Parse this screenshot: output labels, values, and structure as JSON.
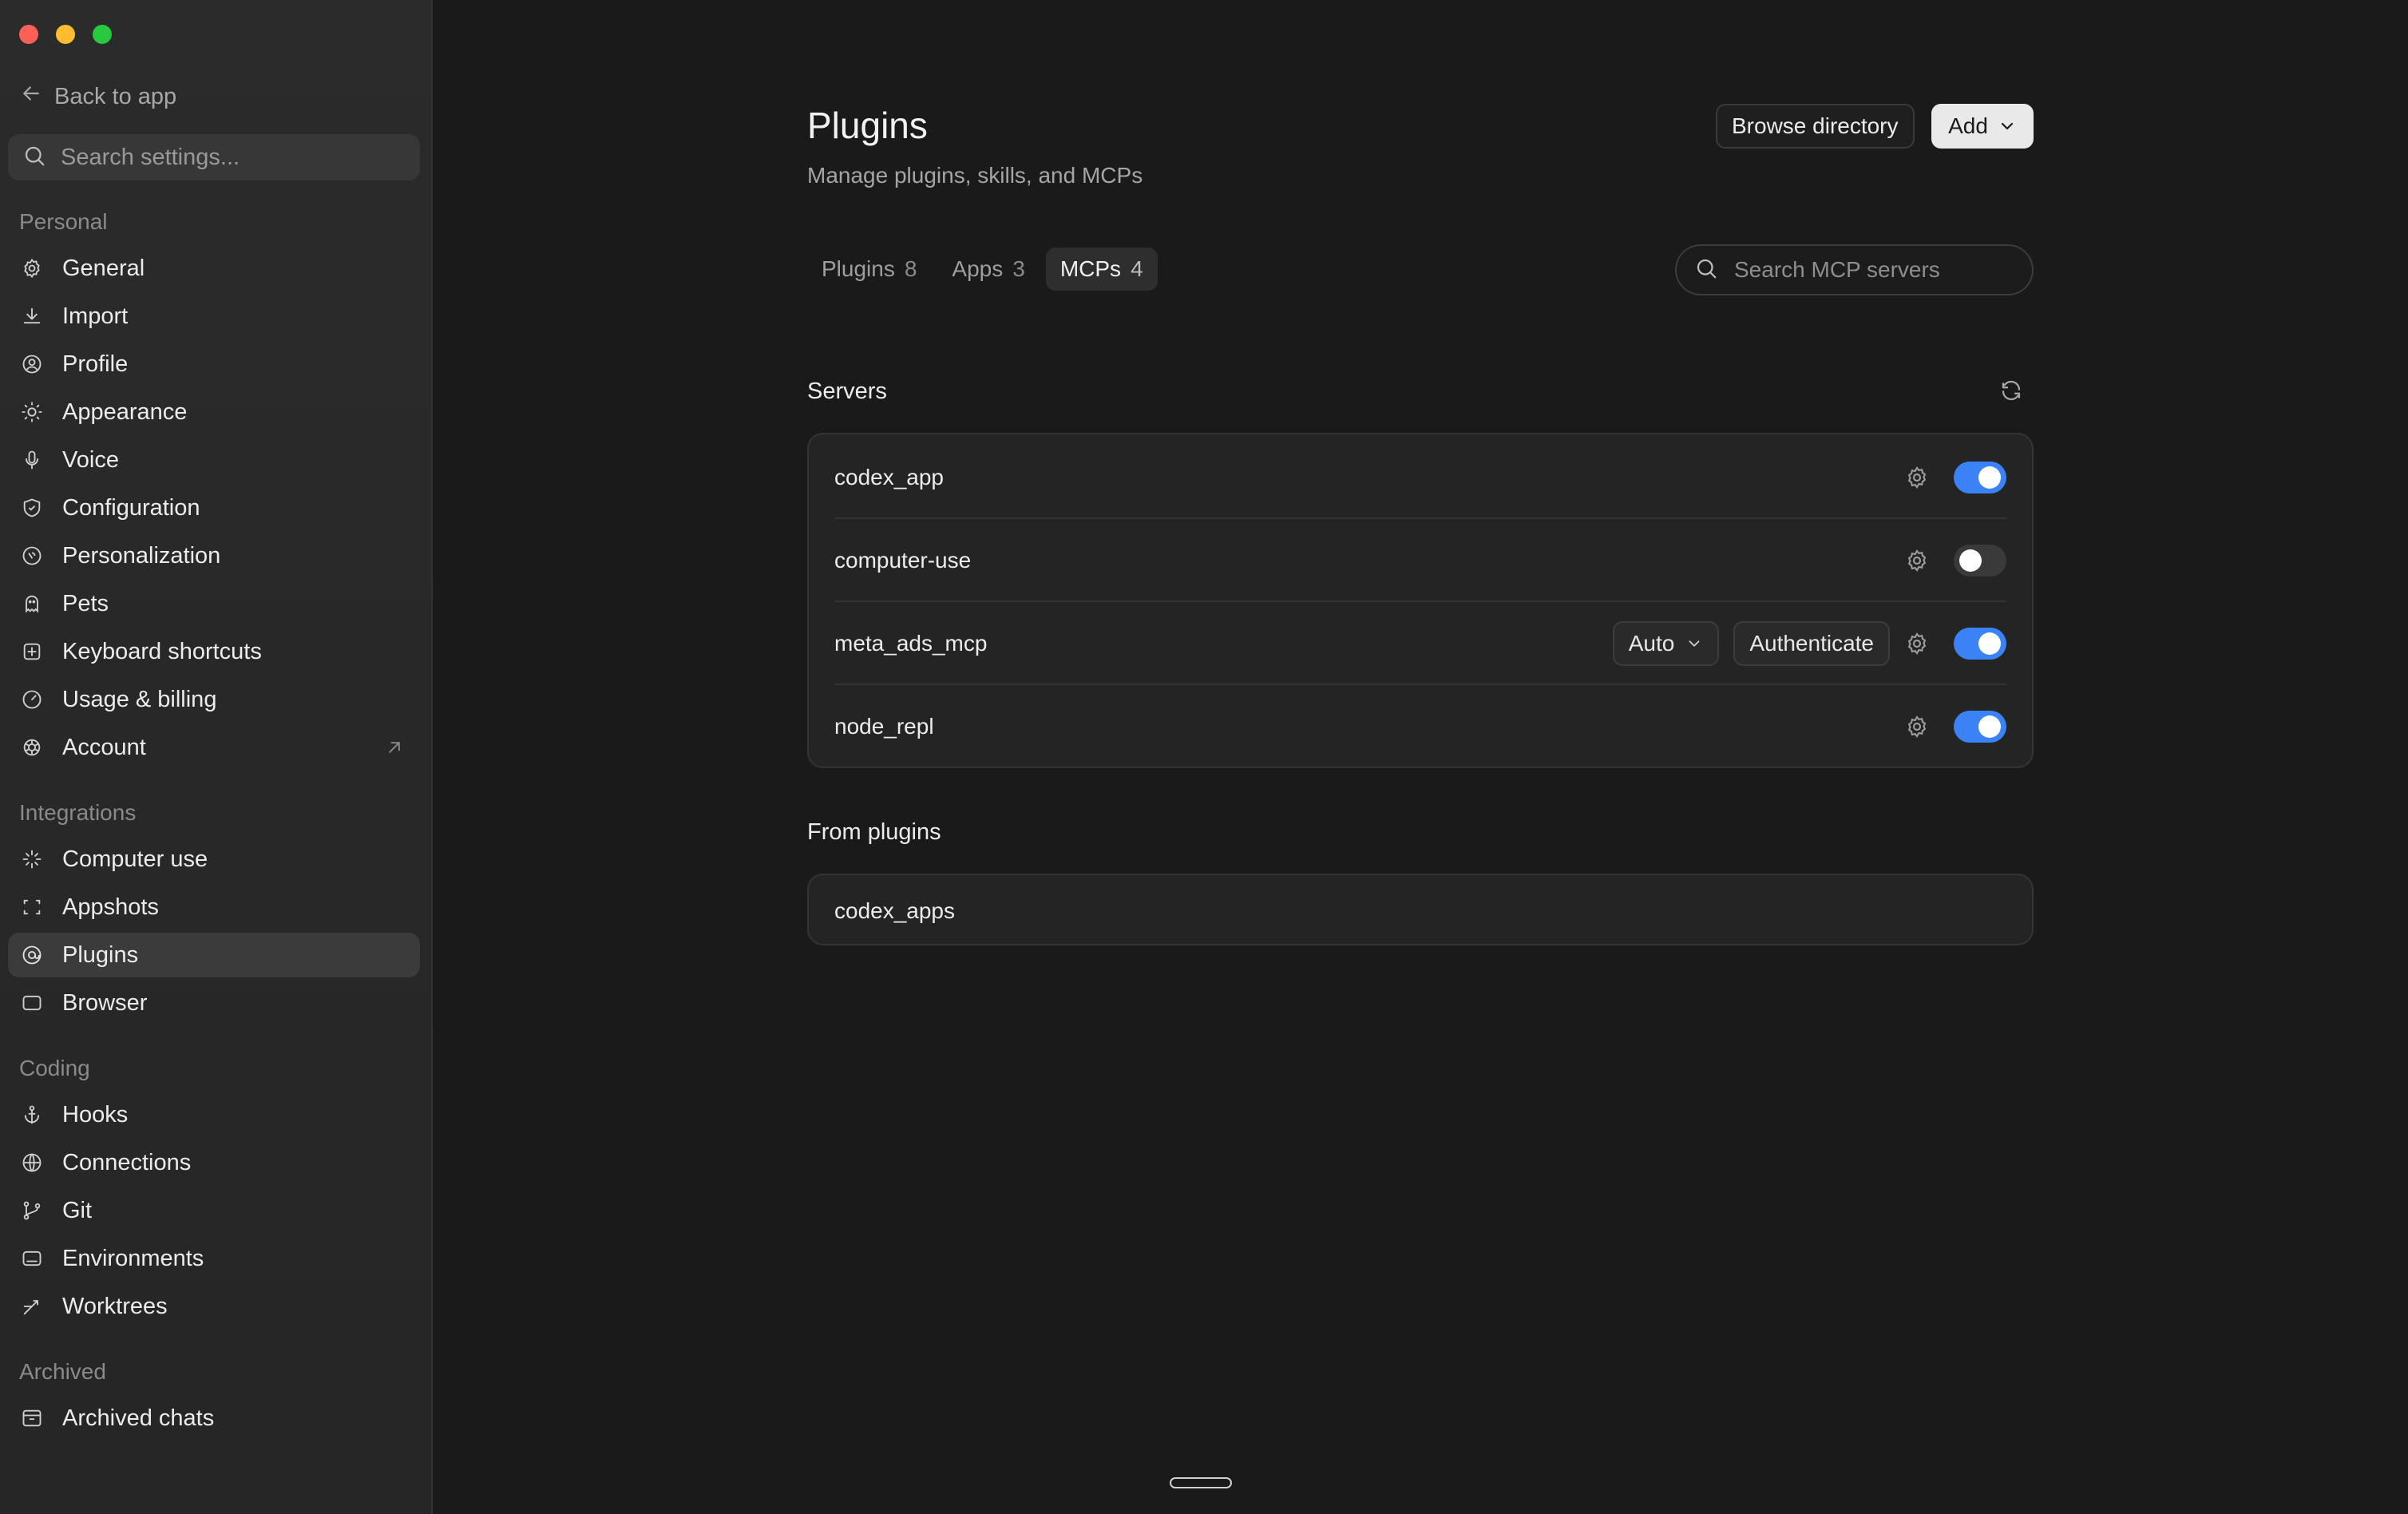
{
  "sidebar": {
    "back_label": "Back to app",
    "search_placeholder": "Search settings...",
    "sections": {
      "personal": "Personal",
      "integrations": "Integrations",
      "coding": "Coding",
      "archived": "Archived"
    },
    "items": {
      "general": "General",
      "import": "Import",
      "profile": "Profile",
      "appearance": "Appearance",
      "voice": "Voice",
      "configuration": "Configuration",
      "personalization": "Personalization",
      "pets": "Pets",
      "keyboard_shortcuts": "Keyboard shortcuts",
      "usage_billing": "Usage & billing",
      "account": "Account",
      "computer_use": "Computer use",
      "appshots": "Appshots",
      "plugins": "Plugins",
      "browser": "Browser",
      "hooks": "Hooks",
      "connections": "Connections",
      "git": "Git",
      "environments": "Environments",
      "worktrees": "Worktrees",
      "archived_chats": "Archived chats"
    },
    "active_item": "Plugins"
  },
  "main": {
    "title": "Plugins",
    "subtitle": "Manage plugins, skills, and MCPs",
    "browse_directory_label": "Browse directory",
    "add_label": "Add",
    "tabs": [
      {
        "label": "Plugins",
        "count": "8"
      },
      {
        "label": "Apps",
        "count": "3"
      },
      {
        "label": "MCPs",
        "count": "4"
      }
    ],
    "active_tab": "MCPs",
    "search_placeholder": "Search MCP servers",
    "servers_heading": "Servers",
    "servers": [
      {
        "name": "codex_app",
        "enabled": true
      },
      {
        "name": "computer-use",
        "enabled": false
      },
      {
        "name": "meta_ads_mcp",
        "enabled": true,
        "mode": "Auto",
        "auth_label": "Authenticate"
      },
      {
        "name": "node_repl",
        "enabled": true
      }
    ],
    "from_plugins_heading": "From plugins",
    "from_plugins": [
      {
        "name": "codex_apps"
      }
    ]
  },
  "colors": {
    "accent": "#3b82f6",
    "sidebar_bg": "#2a2a2a",
    "main_bg": "#1a1a1a",
    "close": "#fe5f57",
    "minimize": "#febc2e",
    "maximize": "#28c840"
  }
}
